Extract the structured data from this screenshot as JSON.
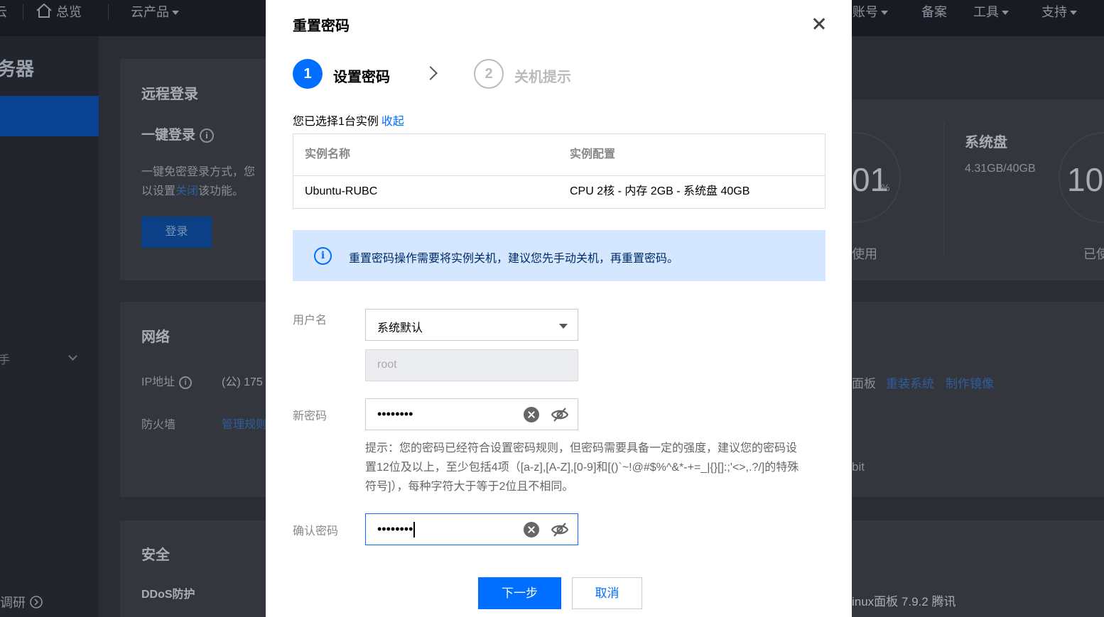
{
  "topbar": {
    "brand_fragment": "云",
    "overview": "总览",
    "products": "云产品",
    "account": "账号",
    "filing": "备案",
    "tools": "工具",
    "support": "支持"
  },
  "sidebar": {
    "title_fragment": "务器",
    "item_fragment": "手",
    "survey": "调研"
  },
  "background": {
    "remote_login_title": "远程登录",
    "one_click_login": "一键登录",
    "desc_line1": "一键免密登录方式，您",
    "desc_line2_prefix": "以设置",
    "desc_line2_link": "关闭",
    "desc_line2_suffix": "该功能。",
    "login_button": "登录",
    "network_title": "网络",
    "ip_label": "IP地址",
    "ip_value": "(公) 175",
    "firewall_label": "防火墙",
    "firewall_link": "管理规则",
    "security_title": "安全",
    "ddos_label": "DDoS防护",
    "cpu_percent_fragment": "01",
    "percent_sign": "%",
    "used_fragment": "使用",
    "system_disk_title": "系统盘",
    "system_disk_value": "4.31GB/40GB",
    "disk_percent_fragment": "10",
    "used2_fragment": "已使",
    "panel_fragment": "面板",
    "reinstall_link": "重装系统",
    "make_image_link": "制作镜像",
    "bit_fragment": "bit",
    "linux_panel": "inux面板 7.9.2 腾讯"
  },
  "modal": {
    "title": "重置密码",
    "steps": [
      {
        "num": "1",
        "label": "设置密码"
      },
      {
        "num": "2",
        "label": "关机提示"
      }
    ],
    "selected_text": "您已选择1台实例",
    "collapse_link": "收起",
    "table": {
      "headers": [
        "实例名称",
        "实例配置"
      ],
      "rows": [
        [
          "Ubuntu-RUBC",
          "CPU 2核 - 内存 2GB - 系统盘 40GB"
        ]
      ]
    },
    "alert_text": "重置密码操作需要将实例关机，建议您先手动关机，再重置密码。",
    "username_label": "用户名",
    "username_select_value": "系统默认",
    "username_disabled_placeholder": "root",
    "new_password_label": "新密码",
    "new_password_masked": "••••••••",
    "hint": "提示：您的密码已经符合设置密码规则，但密码需要具备一定的强度，建议您的密码设置12位及以上，至少包括4项（[a-z],[A-Z],[0-9]和[()`~!@#$%^&*-+=_|{}[]:;'<>,.?/]的特殊符号]），每种字符大于等于2位且不相同。",
    "confirm_password_label": "确认密码",
    "confirm_password_masked": "••••••••",
    "next_button": "下一步",
    "cancel_button": "取消"
  },
  "colors": {
    "primary": "#006eff",
    "alert_bg": "#d5e7ff",
    "overlay_bg": "#2a2d33"
  }
}
